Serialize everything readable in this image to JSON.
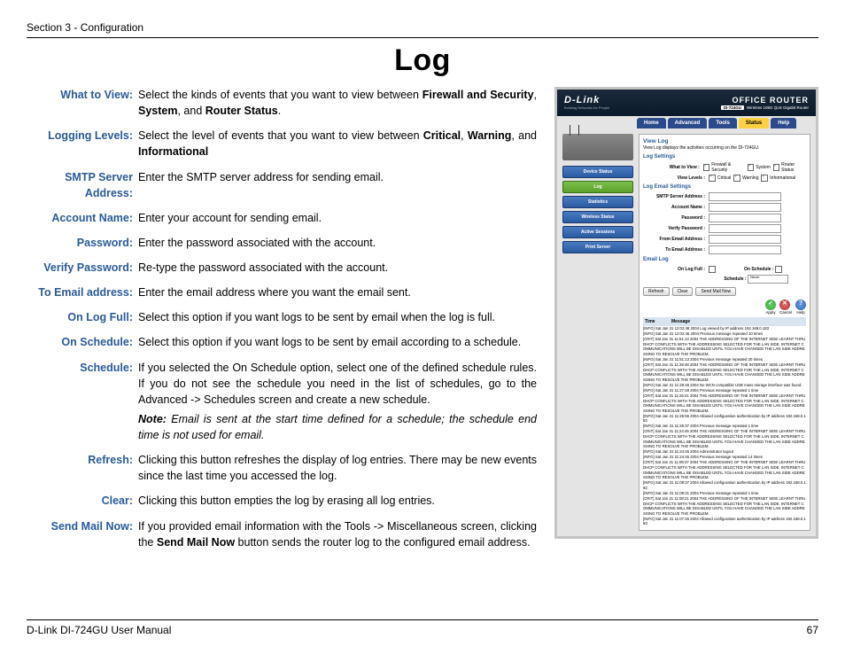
{
  "header_section": "Section 3 - Configuration",
  "title": "Log",
  "footer_left": "D-Link DI-724GU User Manual",
  "footer_right": "67",
  "defs": [
    {
      "label": "What to View:",
      "text": "Select the kinds of events that you want to view between ",
      "bold1": "Firewall and Security",
      "mid1": ", ",
      "bold2": "System",
      "mid2": ", and ",
      "bold3": "Router Status",
      "tail": "."
    },
    {
      "label": "Logging Levels:",
      "text": "Select the level of events that you want to view between ",
      "bold1": "Critical",
      "mid1": ", ",
      "bold2": "Warning",
      "mid2": ", and ",
      "bold3": "Informational",
      "tail": ""
    },
    {
      "label": "SMTP Server Address:",
      "plain": "Enter the SMTP server address for sending email."
    },
    {
      "label": "Account Name:",
      "plain": "Enter your account for sending email."
    },
    {
      "label": "Password:",
      "plain": "Enter the password associated with the account."
    },
    {
      "label": "Verify Password:",
      "plain": "Re-type the password associated with the account."
    },
    {
      "label": "To Email address:",
      "plain": "Enter the email address where you want the email sent."
    },
    {
      "label": "On Log Full:",
      "plain": "Select this option if you want logs to be sent by email when the log is full."
    },
    {
      "label": "On Schedule:",
      "plain": "Select this option if you want logs to be sent by email according to a schedule."
    },
    {
      "label": "Schedule:",
      "plain": "If you selected the On Schedule option, select one of the defined schedule rules. If you do not see the schedule you need in the list of schedules, go to the Advanced -> Schedules screen and create a new schedule.",
      "note_bold": "Note:",
      "note": " Email is sent at the start time defined for a schedule; the schedule end time is not used for email."
    },
    {
      "label": "Refresh:",
      "plain": "Clicking this button refreshes the display of log entries. There may be new events since the last time you accessed the log."
    },
    {
      "label": "Clear:",
      "plain": "Clicking this button empties the log by erasing all log entries."
    },
    {
      "label": "Send Mail Now:",
      "text": "If you provided email information with the Tools -> Miscellaneous screen, clicking the ",
      "bold1": "Send Mail Now",
      "tail": " button sends the router log to the configured email address."
    }
  ],
  "shot": {
    "brand": "D-Link",
    "brand_sub": "Building Networks for People",
    "office": "OFFICE ROUTER",
    "model_code": "DI-724GU",
    "model_desc": "Wireless 108G QoS Gigabit Router",
    "tabs": [
      "Home",
      "Advanced",
      "Tools",
      "Status",
      "Help"
    ],
    "active_tab": 3,
    "side_buttons": [
      "Device Status",
      "Log",
      "Statistics",
      "Wireless Status",
      "Active Sessions",
      "Print Server"
    ],
    "active_side": 1,
    "view_log_title": "View Log",
    "view_log_sub": "View Log displays the activities occurring on the DI-724GU.",
    "sec_log_settings": "Log Settings",
    "row_what_to_view": "What to View :",
    "cb_firewall": "Firewall & Security",
    "cb_system": "System",
    "cb_router": "Router Status",
    "row_view_levels": "View Levels :",
    "cb_critical": "Critical",
    "cb_warning": "Warning",
    "cb_info": "Informational",
    "sec_email": "Log Email Settings",
    "f_smtp": "SMTP Server Address :",
    "f_account": "Account Name :",
    "f_password": "Password :",
    "f_verify": "Verify Password :",
    "f_from": "From Email Address :",
    "f_to": "To Email Address :",
    "sec_email_log": "Email Log",
    "f_onfull": "On Log Full :",
    "f_onsched": "On Schedule :",
    "f_schedule": "Schedule :",
    "sched_val": "Never",
    "btn_refresh": "Refresh",
    "btn_clear": "Clear",
    "btn_send": "Send Mail Now",
    "act_apply": "Apply",
    "act_cancel": "Cancel",
    "act_help": "Help",
    "log_h_time": "Time",
    "log_h_msg": "Message",
    "log_entries": [
      "[INFO] Sat Jan 31 12:02:48 2004 Log viewed by IP address 192.168.0.183",
      "[INFO] Sat Jan 31 12:02:46 2004 Previous message repeated 10 times",
      "[CRIT] Sat Jan 31 11:51:13 2004 THE ADDRESSING OF THE INTERNET SIDE LEARNT THRU DHCP CONFLICTS WITH THE ADDRESSING SELECTED FOR THE LAN SIDE. INTERNET COMMUNICATIONS WILL BE DISABLED UNTIL YOU HAVE CHANGED THE LAN SIDE ADDRESSING TO RESOLVE THE PROBLEM.",
      "[INFO] Sat Jan 31 11:51:13 2004 Previous message repeated 20 times",
      "[CRIT] Sat Jan 31 11:28:48 2004 THE ADDRESSING OF THE INTERNET SIDE LEARNT THRU DHCP CONFLICTS WITH THE ADDRESSING SELECTED FOR THE LAN SIDE. INTERNET COMMUNICATIONS WILL BE DISABLED UNTIL YOU HAVE CHANGED THE LAN SIDE ADDRESSING TO RESOLVE THE PROBLEM.",
      "[INFO] Sat Jan 31 11:28:48 2004 No WCN compatible USB mass storage interface was found",
      "[INFO] Sat Jan 31 11:27:48 2004 Previous message repeated 1 time",
      "[CRIT] Sat Jan 31 11:26:41 2004 THE ADDRESSING OF THE INTERNET SIDE LEARNT THRU DHCP CONFLICTS WITH THE ADDRESSING SELECTED FOR THE LAN SIDE. INTERNET COMMUNICATIONS WILL BE DISABLED UNTIL YOU HAVE CHANGED THE LAN SIDE ADDRESSING TO RESOLVE THE PROBLEM.",
      "[INFO] Sat Jan 31 11:25:55 2004 Allowed configuration authentication by IP address 192.168.0.183",
      "[INFO] Sat Jan 31 11:25:37 2004 Previous message repeated 1 time",
      "[CRIT] Sat Jan 31 11:24:45 2004 THE ADDRESSING OF THE INTERNET SIDE LEARNT THRU DHCP CONFLICTS WITH THE ADDRESSING SELECTED FOR THE LAN SIDE. INTERNET COMMUNICATIONS WILL BE DISABLED UNTIL YOU HAVE CHANGED THE LAN SIDE ADDRESSING TO RESOLVE THE PROBLEM.",
      "[INFO] Sat Jan 31 11:24:45 2004 Administrator logout",
      "[INFO] Sat Jan 31 11:24:45 2004 Previous message repeated 14 times",
      "[CRIT] Sat Jan 31 11:09:37 2004 THE ADDRESSING OF THE INTERNET SIDE LEARNT THRU DHCP CONFLICTS WITH THE ADDRESSING SELECTED FOR THE LAN SIDE. INTERNET COMMUNICATIONS WILL BE DISABLED UNTIL YOU HAVE CHANGED THE LAN SIDE ADDRESSING TO RESOLVE THE PROBLEM.",
      "[INFO] Sat Jan 31 11:09:37 2004 Allowed configuration authentication by IP address 192.168.0.183",
      "[INFO] Sat Jan 31 11:09:21 2004 Previous message repeated 1 time",
      "[CRIT] Sat Jan 31 11:08:21 2004 THE ADDRESSING OF THE INTERNET SIDE LEARNT THRU DHCP CONFLICTS WITH THE ADDRESSING SELECTED FOR THE LAN SIDE. INTERNET COMMUNICATIONS WILL BE DISABLED UNTIL YOU HAVE CHANGED THE LAN SIDE ADDRESSING TO RESOLVE THE PROBLEM.",
      "[INFO] Sat Jan 31 11:07:26 2004 Allowed configuration authentication by IP address 192.168.0.183"
    ]
  }
}
